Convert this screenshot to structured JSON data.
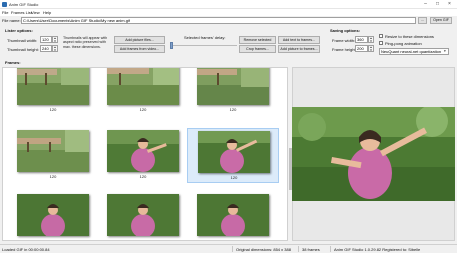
{
  "window": {
    "title": "Anim GIF Studio"
  },
  "menu": [
    "File",
    "Frames List",
    "View",
    "Help"
  ],
  "file_bar": {
    "label": "File name:",
    "path": "C:\\Users\\User\\Documents\\Anim GIF Studio\\My new anim.gif",
    "browse_label": "...",
    "open_label": "Open GIF"
  },
  "lister": {
    "heading": "Lister options:",
    "width_label": "Thumbnail width:",
    "width_value": "120",
    "height_label": "Thumbnail height:",
    "height_value": "240",
    "note": "Thumbnails will appear with aspect ratio preserved with max. these dimensions.",
    "add_files": "Add picture files...",
    "add_video": "Add frames from video..."
  },
  "delay": {
    "label": "Selected frames' delay:"
  },
  "actions": {
    "remove": "Remove selected",
    "add_text": "Add text to frames...",
    "crop": "Crop frames...",
    "add_picture": "Add picture to frames..."
  },
  "saving": {
    "heading": "Saving options:",
    "width_label": "Frame width:",
    "width_value": "360",
    "height_label": "Frame height:",
    "height_value": "200",
    "resize_label": "Resize to these dimensions",
    "loop_label": "Ping-pong animation",
    "quant_value": "NeuQuant neural-net quantization"
  },
  "frames": {
    "heading": "Frames:",
    "items": [
      "120",
      "120",
      "120",
      "120",
      "120",
      "120"
    ]
  },
  "status": {
    "left": "Loaded GIF in 00:00:00.84",
    "dims": "Original dimensions: 854 x 388",
    "count": "38 frames",
    "version": "Anim GIF Studio 1.0.29.82 Registered to: Sibelle"
  }
}
